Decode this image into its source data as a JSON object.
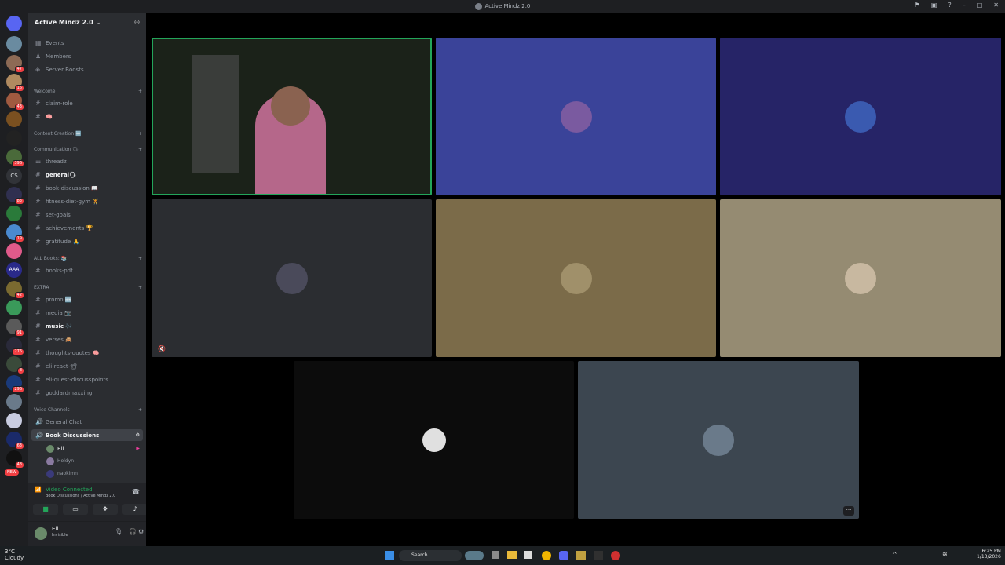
{
  "window": {
    "title": "Active Mindz 2.0"
  },
  "server": {
    "name": "Active Mindz 2.0",
    "top_items": [
      "Events",
      "Members",
      "Server Boosts"
    ],
    "categories": {
      "welcome": "Welcome",
      "content_creation": "Content Creation 🆕",
      "communication": "Communication 🗣",
      "all_books": "ALL Books: 📚",
      "extra": "EXTRA",
      "voice_channels": "Voice Channels"
    },
    "channels": {
      "claim_role": "claim-role",
      "hash_emoji": "🧠",
      "threadz": "threadz",
      "general": "general🗣",
      "book_discussion": "book-discussion 📖",
      "fitness": "fitness-diet-gym 🏋",
      "set_goals": "set-goals",
      "achievements": "achievements 🏆",
      "gratitude": "gratitude 🙏",
      "books_pdf": "books-pdf",
      "promo": "promo 🆕",
      "media": "media 📷",
      "music": "music 🎶",
      "verses": "verses 🙈",
      "thoughts": "thoughts-quotes 🧠",
      "eli_react": "eli-react-📽",
      "eli_quest": "eli-quest-discusspoints",
      "goddard": "goddardmaxxing",
      "general_chat": "General Chat",
      "book_discussions_voice": "Book Discussions"
    },
    "voice_members": [
      "Eli",
      "Holdyn",
      "naokimn"
    ]
  },
  "guild_badges": [
    "47",
    "16",
    "43",
    "396",
    "CS",
    "83",
    "19",
    "AAA",
    "42",
    "91",
    "276",
    "8",
    "296",
    "63",
    "48",
    "NEW"
  ],
  "voice_panel": {
    "status": "Video Connected",
    "location": "Book Discussions / Active Mindz 2.0"
  },
  "user": {
    "name": "Eli",
    "status": "Invisible"
  },
  "taskbar": {
    "weather_temp": "3°C",
    "weather_text": "Cloudy",
    "search": "Search",
    "time": "6:25 PM",
    "date": "1/13/2026"
  },
  "colors": {
    "accent": "#23a55a",
    "tile_blue": "#3a4399",
    "tile_navy": "#262467",
    "tile_dark": "#2b2d31",
    "tile_brown": "#7b6b49",
    "tile_tan": "#958b72",
    "tile_black": "#0c0c0c",
    "tile_slate": "#3c4650"
  }
}
